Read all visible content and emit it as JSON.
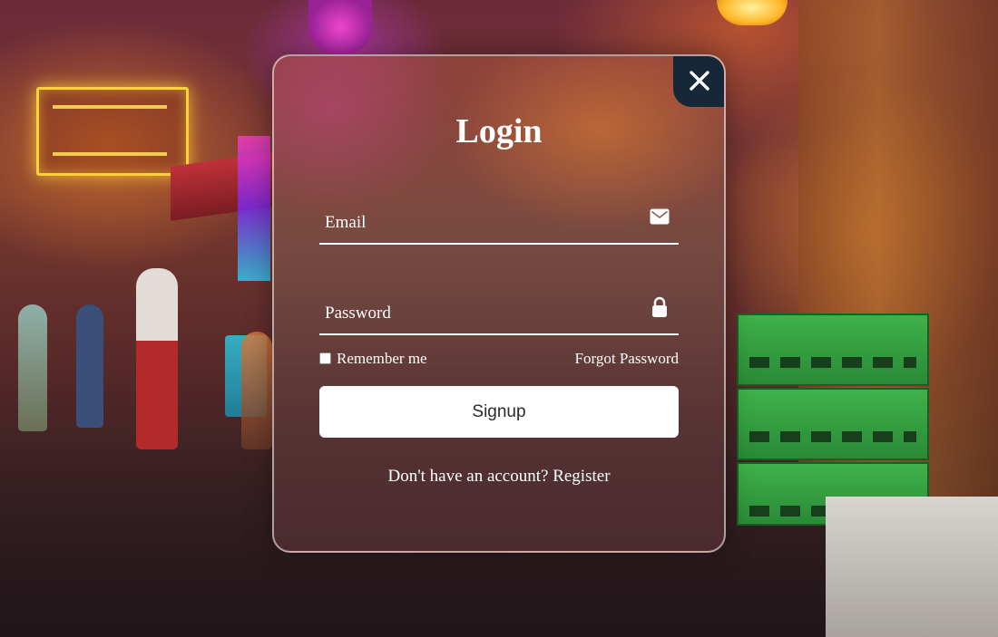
{
  "login": {
    "title": "Login",
    "close_icon": "close-icon",
    "email": {
      "label": "Email",
      "value": "",
      "icon": "envelope-icon"
    },
    "password": {
      "label": "Password",
      "value": "",
      "icon": "lock-icon"
    },
    "remember_label": "Remember me",
    "remember_checked": false,
    "forgot_label": "Forgot Password",
    "submit_label": "Signup",
    "register_prompt": "Don't have an account?",
    "register_link": "Register"
  },
  "colors": {
    "close_button_bg": "#162838",
    "text": "#ffffff",
    "button_bg": "#ffffff",
    "button_text": "#2a2a2a"
  }
}
